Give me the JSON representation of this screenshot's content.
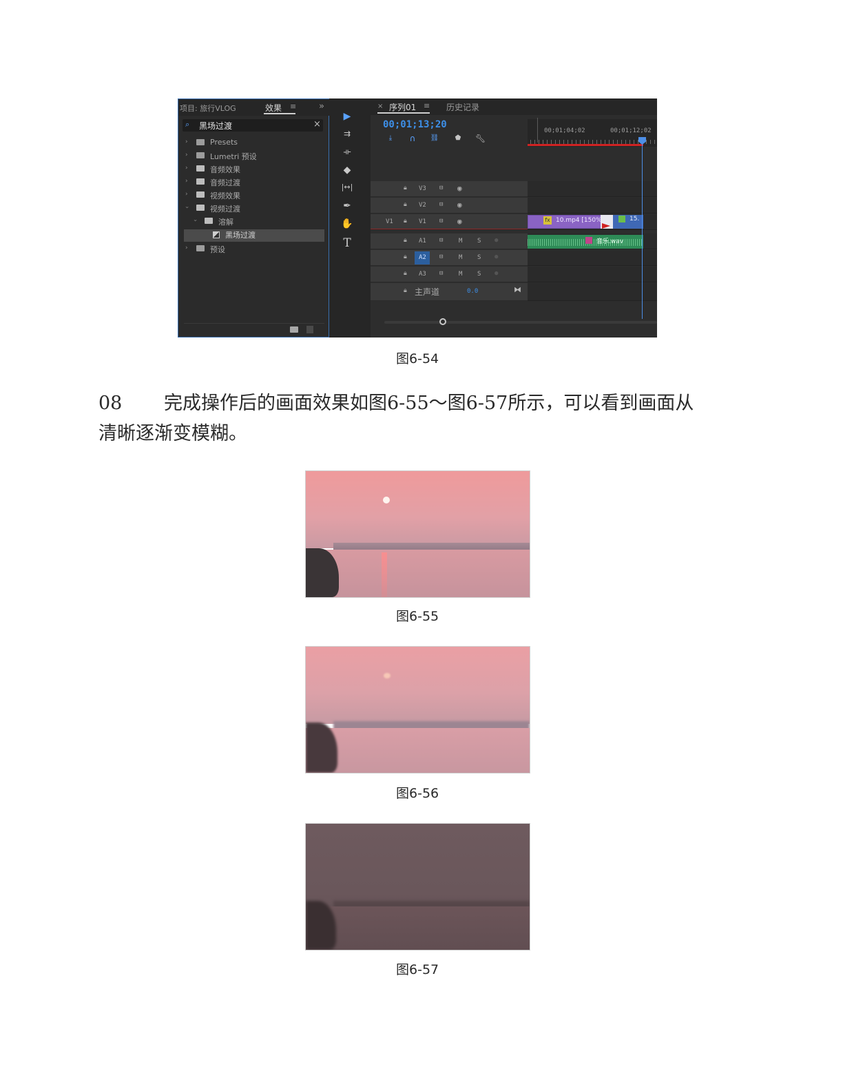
{
  "figure_captions": [
    "图6-54",
    "图6-55",
    "图6-56",
    "图6-57"
  ],
  "step_number": "08",
  "step_text_line1": "完成操作后的画面效果如图6-55～图6-57所示，可以看到画面从",
  "step_text_line2": "清晰逐渐变模糊。",
  "premiere": {
    "project_tab": "项目: 旅行VLOG",
    "effects_tab": "效果",
    "menu_glyph": "≡",
    "more_glyph": "»",
    "search_value": "黑场过渡",
    "search_clear": "×",
    "tree": {
      "presets": "Presets",
      "lumetri": "Lumetri 预设",
      "audio_effects": "音频效果",
      "audio_transitions": "音频过渡",
      "video_effects": "视频效果",
      "video_transitions": "视频过渡",
      "dissolve": "溶解",
      "dip_to_black": "黑场过渡",
      "user_presets": "预设"
    },
    "sequence_tab": "序列01",
    "history_tab": "历史记录",
    "close_glyph": "×",
    "timecode": "00;01;13;20",
    "ruler_ticks": [
      "00;01;04;02",
      "00;01;12;02"
    ],
    "tracks": {
      "v3": "V3",
      "v2": "V2",
      "v1": "V1",
      "v1_source": "V1",
      "a1": "A1",
      "a2": "A2",
      "a3": "A3",
      "mute": "M",
      "solo": "S",
      "master": "主声道",
      "master_value": "0.0"
    },
    "clips": {
      "video_clip": "10.mp4 [150%]",
      "video_clip2": "15.",
      "fx_badge": "fx",
      "audio_clip": "音乐.wav"
    },
    "colors": {
      "accent_blue": "#3d8fe8",
      "video_clip": "#8a63c4",
      "audio_clip": "#2e8b57",
      "ruler_red": "#d02222"
    }
  }
}
